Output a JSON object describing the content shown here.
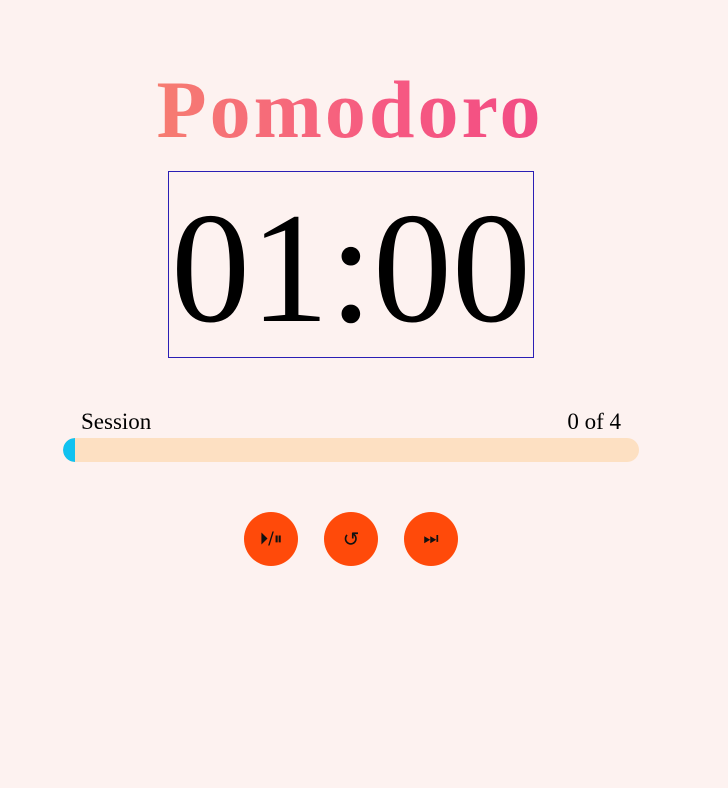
{
  "app": {
    "title": "Pomodoro"
  },
  "timer": {
    "display": "01:00"
  },
  "session": {
    "label": "Session",
    "count": "0 of 4",
    "progress_percent": 2
  },
  "controls": {
    "play_pause_icon": "⏵/⏸",
    "reset_icon": "↺",
    "skip_icon": "⏭"
  },
  "colors": {
    "background": "#fdf2f0",
    "title_gradient_start": "#f79465",
    "title_gradient_end": "#ee3d86",
    "progress_track": "#fde0c2",
    "progress_fill": "#11c2f0",
    "button": "#ff4a0a",
    "timer_border": "#2a1fb5"
  }
}
